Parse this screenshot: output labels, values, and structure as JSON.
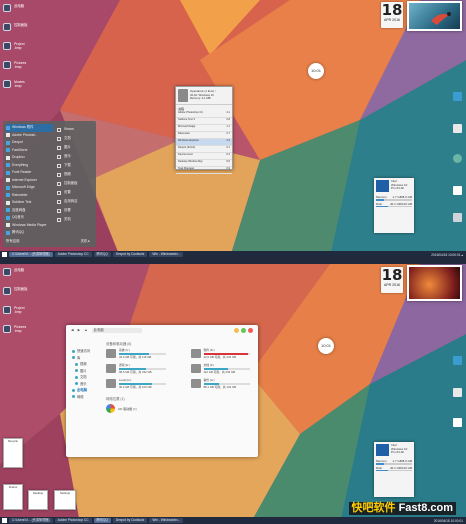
{
  "top": {
    "desktop_icons": [
      {
        "label": "此电脑"
      },
      {
        "label": "控制面板"
      },
      {
        "label": "Project\n.bmp"
      },
      {
        "label": "Pictures\n.bmp"
      },
      {
        "label": "Movies\n.bmp"
      }
    ],
    "clock": {
      "day": "18",
      "month": "APR 2016"
    },
    "round_clock": "10:01",
    "start_menu": {
      "left_items": [
        "Windows 附件",
        "Adobe Photosh..",
        "Dexpot",
        "FastStone",
        "Dropbox",
        "Everything",
        "Foxit Reader",
        "Internet Explorer",
        "Microsoft Edge",
        "Rainmeter",
        "Sublime Text",
        "百度网盘",
        "QQ音乐",
        "Windows Media Player",
        "腾讯QQ"
      ],
      "right_items": [
        "Steam",
        "文档",
        "图片",
        "音乐",
        "下载",
        "视频",
        "控制面板",
        "设置",
        "应用商店",
        "设置",
        "关机"
      ],
      "all_apps": "所有应用",
      "power": "关机  ▸"
    },
    "task_manager": {
      "header": [
        "Operations (1 Item) ↑",
        "32-bit: Windows 10",
        "Memory: 4.1 MB"
      ],
      "section": "进程",
      "rows": [
        {
          "name": "Adobe Photoshop CC",
          "val": "4.1"
        },
        {
          "name": "Sublime Text 3",
          "val": "0.8"
        },
        {
          "name": "Microsoft Edge",
          "val": "1.1"
        },
        {
          "name": "Rainmeter",
          "val": "2.7"
        },
        {
          "name": "Windows Explorer",
          "val": "3.2"
        },
        {
          "name": "Dexpot (32-bit)",
          "val": "0.1"
        },
        {
          "name": "Service Host",
          "val": "0.4"
        },
        {
          "name": "Desktop Window Mgr",
          "val": "5.6"
        },
        {
          "name": "Task Manager",
          "val": "0.9"
        }
      ]
    },
    "sys_widget": {
      "title": "Intel",
      "l1": "Windows 10",
      "l2": "Pro 64-bit",
      "mem_label": "Memory",
      "mem_val": "1.7 GB/8.0 GB",
      "disk_label": "Disk",
      "disk_val": "40.1 GB/120 GB",
      "mem_pct": 21,
      "disk_pct": 33
    },
    "right_icons": [
      "Recycle",
      "Chrome",
      "Steam",
      "Network",
      "设置"
    ]
  },
  "taskbar_top": {
    "items": [
      "C:\\Users\\Vi... (资源管理器)",
      "Adobe Photoshop CC",
      "腾讯QQ",
      "Dexpot by Cooltoolz",
      "Win - Windowsfxx..."
    ],
    "active_index": 0,
    "right": "2016/04/18  10:00:01  ▴"
  },
  "bottom": {
    "clock": {
      "day": "18",
      "month": "APR 2016"
    },
    "round_clock": "10:01",
    "explorer": {
      "address": "此电脑",
      "sidebar": [
        {
          "label": "快速访问",
          "sub": false
        },
        {
          "label": "库",
          "sub": false
        },
        {
          "label": "视频",
          "sub": true
        },
        {
          "label": "图片",
          "sub": true
        },
        {
          "label": "文档",
          "sub": true
        },
        {
          "label": "音乐",
          "sub": true
        },
        {
          "label": "此电脑",
          "sub": false,
          "sel": true
        },
        {
          "label": "网络",
          "sub": false
        }
      ],
      "section_drives": "设备和驱动器 (6)",
      "drives": [
        {
          "name": "系统 (C:)",
          "free": "43.2 GB 可用，共 119 GB",
          "pct": 64,
          "alert": false
        },
        {
          "name": "软件 (D:)",
          "free": "12.6 GB 可用，共 232 GB",
          "pct": 95,
          "alert": true
        },
        {
          "name": "游戏 (E:)",
          "free": "98.5 GB 可用，共 232 GB",
          "pct": 58,
          "alert": false
        },
        {
          "name": "文档 (F:)",
          "free": "112 GB 可用，共 232 GB",
          "pct": 52,
          "alert": false
        },
        {
          "name": "Local (G:)",
          "free": "30.2 GB 可用，共 100 GB",
          "pct": 70,
          "alert": false
        },
        {
          "name": "备份 (H:)",
          "free": "88.1 GB 可用，共 132 GB",
          "pct": 33,
          "alert": false
        }
      ],
      "section_net": "网络位置 (1)",
      "net_item": "CD 驱动器 (I:)"
    },
    "sys_widget": {
      "title": "Intel",
      "l1": "Windows 10",
      "l2": "Pro 64-bit",
      "mem_label": "Memory",
      "mem_val": "1.7 GB/8.0 GB",
      "disk_label": "Disk",
      "disk_val": "40.1 GB/120 GB",
      "mem_pct": 21,
      "disk_pct": 33
    },
    "thumbs": [
      "Recycle",
      "Firefox",
      "Desktop",
      "Settings",
      "Chrome"
    ]
  },
  "taskbar_bot": {
    "items": [
      "C:\\Users\\Vi... (资源管理器)",
      "Adobe Photoshop CC",
      "腾讯QQ",
      "Dexpot by Cooltoolz",
      "Win - Windowsfxx..."
    ],
    "active_index": 2,
    "right": "2016/04/18  10:00:01"
  },
  "watermark": {
    "cn": "快吧软件",
    "en": " Fast8.com"
  }
}
